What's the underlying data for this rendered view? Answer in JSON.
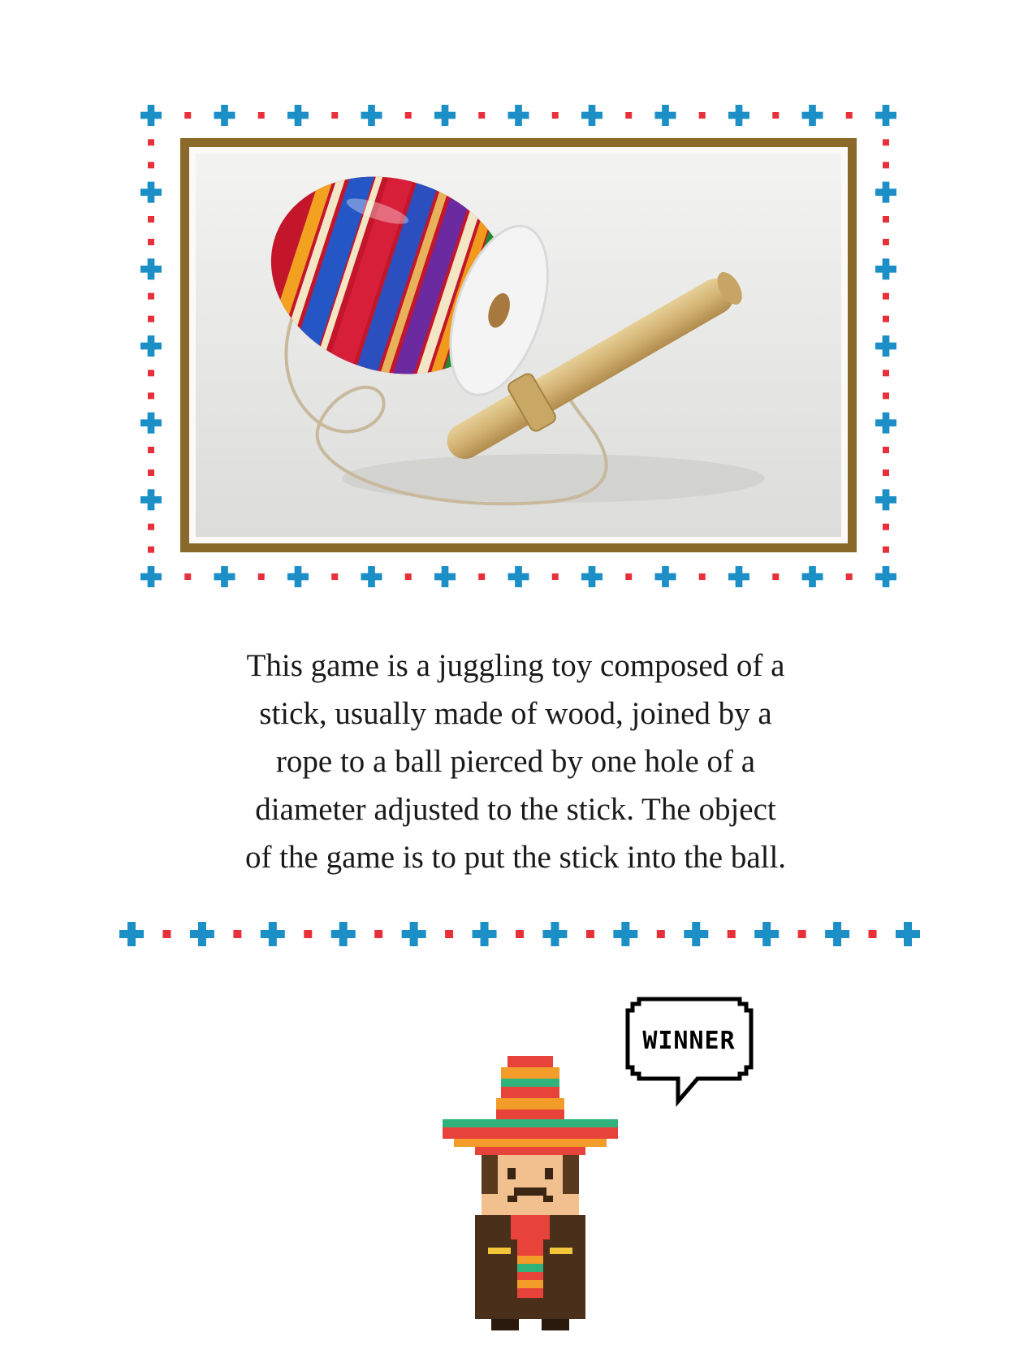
{
  "photo": {
    "alt": "Balero toy",
    "colors": {
      "frame": "#8a6a2a",
      "cross": "#1b8fc6",
      "dot": "#e8303a"
    }
  },
  "description": {
    "text": "This game is a juggling toy composed of  a\nstick, usually made of  wood, joined by a\nrope to a ball pierced by one hole of  a\ndiameter adjusted to the stick. The object\nof  the game is to put the stick into the ball."
  },
  "mascot": {
    "speech_bubble": "WINNER",
    "icon": "mariachi-pixel-character-icon"
  }
}
